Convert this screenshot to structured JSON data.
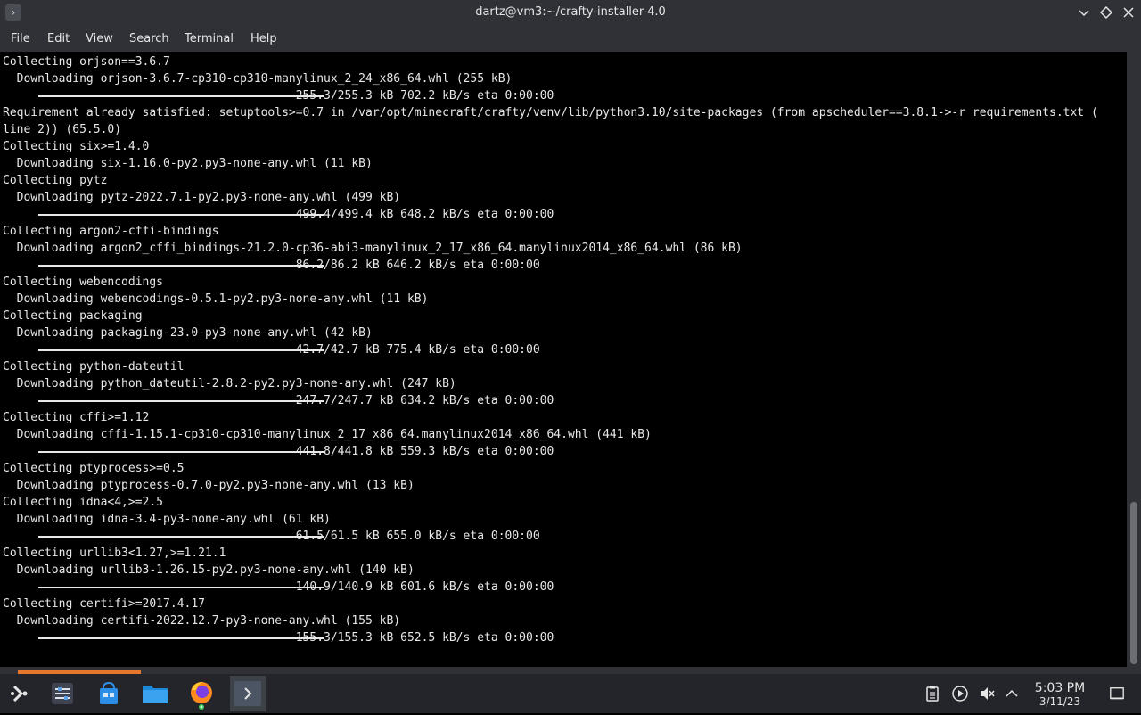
{
  "window": {
    "title": "dartz@vm3:~/crafty-installer-4.0",
    "app_icon_glyph": "›",
    "controls": {
      "minimize_glyph": "⌄",
      "maximize_glyph": "◇",
      "close_glyph": "✕"
    }
  },
  "menubar": {
    "items": [
      "File",
      "Edit",
      "View",
      "Search",
      "Terminal",
      "Help"
    ]
  },
  "terminal": {
    "lines": [
      "Collecting orjson==3.6.7",
      "  Downloading orjson-3.6.7-cp310-cp310-manylinux_2_24_x86_64.whl (255 kB)",
      "                                          255.3/255.3 kB 702.2 kB/s eta 0:00:00",
      "Requirement already satisfied: setuptools>=0.7 in /var/opt/minecraft/crafty/venv/lib/python3.10/site-packages (from apscheduler==3.8.1->-r requirements.txt (",
      "line 2)) (65.5.0)",
      "Collecting six>=1.4.0",
      "  Downloading six-1.16.0-py2.py3-none-any.whl (11 kB)",
      "Collecting pytz",
      "  Downloading pytz-2022.7.1-py2.py3-none-any.whl (499 kB)",
      "                                          499.4/499.4 kB 648.2 kB/s eta 0:00:00",
      "Collecting argon2-cffi-bindings",
      "  Downloading argon2_cffi_bindings-21.2.0-cp36-abi3-manylinux_2_17_x86_64.manylinux2014_x86_64.whl (86 kB)",
      "                                          86.2/86.2 kB 646.2 kB/s eta 0:00:00",
      "Collecting webencodings",
      "  Downloading webencodings-0.5.1-py2.py3-none-any.whl (11 kB)",
      "Collecting packaging",
      "  Downloading packaging-23.0-py3-none-any.whl (42 kB)",
      "                                          42.7/42.7 kB 775.4 kB/s eta 0:00:00",
      "Collecting python-dateutil",
      "  Downloading python_dateutil-2.8.2-py2.py3-none-any.whl (247 kB)",
      "                                          247.7/247.7 kB 634.2 kB/s eta 0:00:00",
      "Collecting cffi>=1.12",
      "  Downloading cffi-1.15.1-cp310-cp310-manylinux_2_17_x86_64.manylinux2014_x86_64.whl (441 kB)",
      "                                          441.8/441.8 kB 559.3 kB/s eta 0:00:00",
      "Collecting ptyprocess>=0.5",
      "  Downloading ptyprocess-0.7.0-py2.py3-none-any.whl (13 kB)",
      "Collecting idna<4,>=2.5",
      "  Downloading idna-3.4-py3-none-any.whl (61 kB)",
      "                                          61.5/61.5 kB 655.0 kB/s eta 0:00:00",
      "Collecting urllib3<1.27,>=1.21.1",
      "  Downloading urllib3-1.26.15-py2.py3-none-any.whl (140 kB)",
      "                                          140.9/140.9 kB 601.6 kB/s eta 0:00:00",
      "Collecting certifi>=2017.4.17",
      "  Downloading certifi-2022.12.7-py3-none-any.whl (155 kB)",
      "                                          155.3/155.3 kB 652.5 kB/s eta 0:00:00"
    ],
    "progress_bar_rows": [
      2,
      9,
      12,
      17,
      20,
      23,
      28,
      31,
      34
    ]
  },
  "taskbar": {
    "launcher_icon": "steam-deck-launcher-icon",
    "apps": [
      {
        "name": "system-settings",
        "icon": "sliders-icon"
      },
      {
        "name": "discover",
        "icon": "store-bag-icon"
      },
      {
        "name": "dolphin",
        "icon": "folder-icon"
      },
      {
        "name": "firefox",
        "icon": "firefox-icon"
      },
      {
        "name": "konsole",
        "icon": "terminal-icon",
        "active": true
      }
    ],
    "tray": [
      "clipboard-icon",
      "media-play-icon",
      "volume-muted-icon",
      "chevron-up-icon"
    ],
    "clock": {
      "time": "5:03 PM",
      "date": "3/11/23"
    },
    "show_desktop_icon": "show-desktop-icon"
  },
  "colors": {
    "chrome": "#2f3136",
    "taskbar": "#23252a",
    "terminal_bg": "#000000",
    "terminal_fg": "#e8e8e8",
    "accent_orange": "#e8772e"
  }
}
